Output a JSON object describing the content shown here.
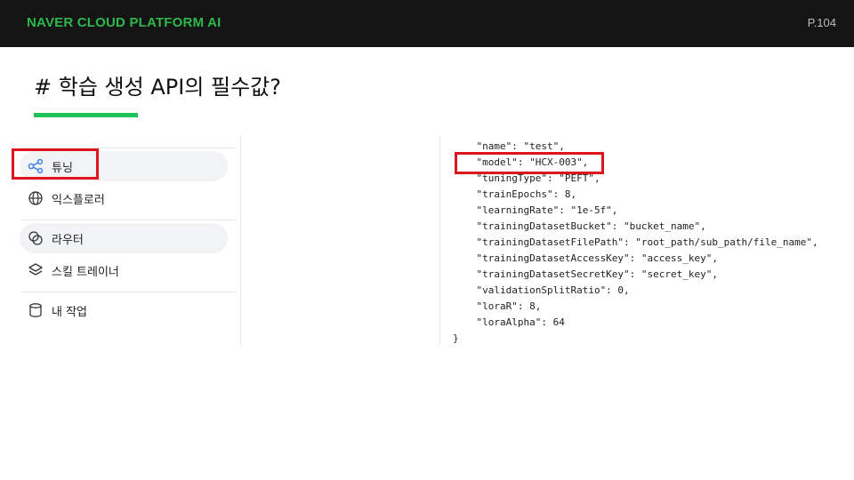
{
  "header": {
    "brand": "NAVER CLOUD PLATFORM  AI",
    "page": "P.104"
  },
  "title": "# 학습 생성 API의 필수값?",
  "sidebar": {
    "items": [
      {
        "label": "튜닝",
        "icon": "share-nodes-icon"
      },
      {
        "label": "익스플로러",
        "icon": "globe-icon"
      },
      {
        "label": "라우터",
        "icon": "overlap-circles-icon"
      },
      {
        "label": "스킬 트레이너",
        "icon": "layers-icon"
      },
      {
        "label": "내 작업",
        "icon": "database-icon"
      }
    ]
  },
  "code": {
    "lines": [
      "    \"name\": \"test\",",
      "    \"model\": \"HCX-003\",",
      "    \"tuningType\": \"PEFT\",",
      "    \"trainEpochs\": 8,",
      "    \"learningRate\": \"1e-5f\",",
      "    \"trainingDatasetBucket\": \"bucket_name\",",
      "    \"trainingDatasetFilePath\": \"root_path/sub_path/file_name\",",
      "    \"trainingDatasetAccessKey\": \"access_key\",",
      "    \"trainingDatasetSecretKey\": \"secret_key\",",
      "    \"validationSplitRatio\": 0,",
      "    \"loraR\": 8,",
      "    \"loraAlpha\": 64",
      "}"
    ]
  },
  "colors": {
    "brand": "#2db84d",
    "accent_underline": "#22c25a",
    "highlight_box": "#e0141b",
    "topbar": "#141414"
  }
}
